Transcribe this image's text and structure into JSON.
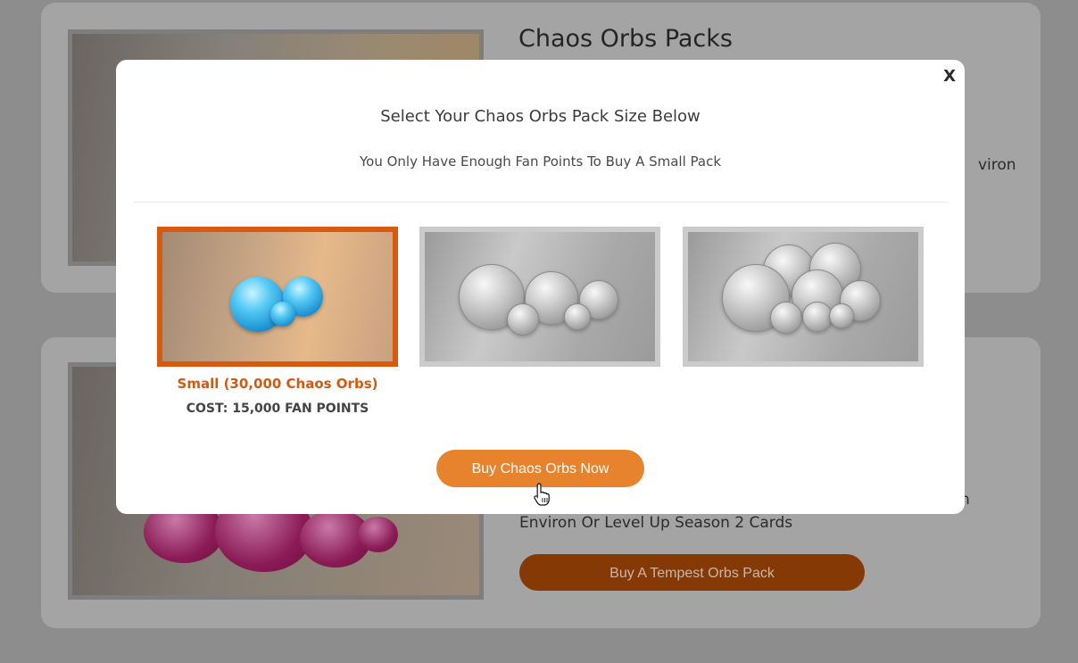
{
  "background": {
    "card1": {
      "title": "Chaos Orbs Packs",
      "text_fragment": "viron"
    },
    "card2": {
      "text_line": "Environ Or Level Up Season 2 Cards",
      "text_fragment": "n",
      "button_label": "Buy A Tempest Orbs Pack"
    }
  },
  "modal": {
    "close_label": "X",
    "title": "Select Your Chaos Orbs Pack Size Below",
    "subtitle": "You Only Have Enough Fan Points To Buy A Small Pack",
    "packs": [
      {
        "name": "small",
        "selected": true,
        "orb_color": "blue"
      },
      {
        "name": "medium",
        "selected": false,
        "orb_color": "gray"
      },
      {
        "name": "large",
        "selected": false,
        "orb_color": "gray"
      }
    ],
    "selected_label": "Small (30,000 Chaos Orbs)",
    "selected_cost": "COST: 15,000 FAN POINTS",
    "buy_button": "Buy Chaos Orbs Now"
  },
  "colors": {
    "accent": "#e8832d",
    "selected_border": "#d85a0f",
    "tempest_button": "#853a06"
  },
  "icons": {
    "cursor": "hand-pointer-icon"
  }
}
